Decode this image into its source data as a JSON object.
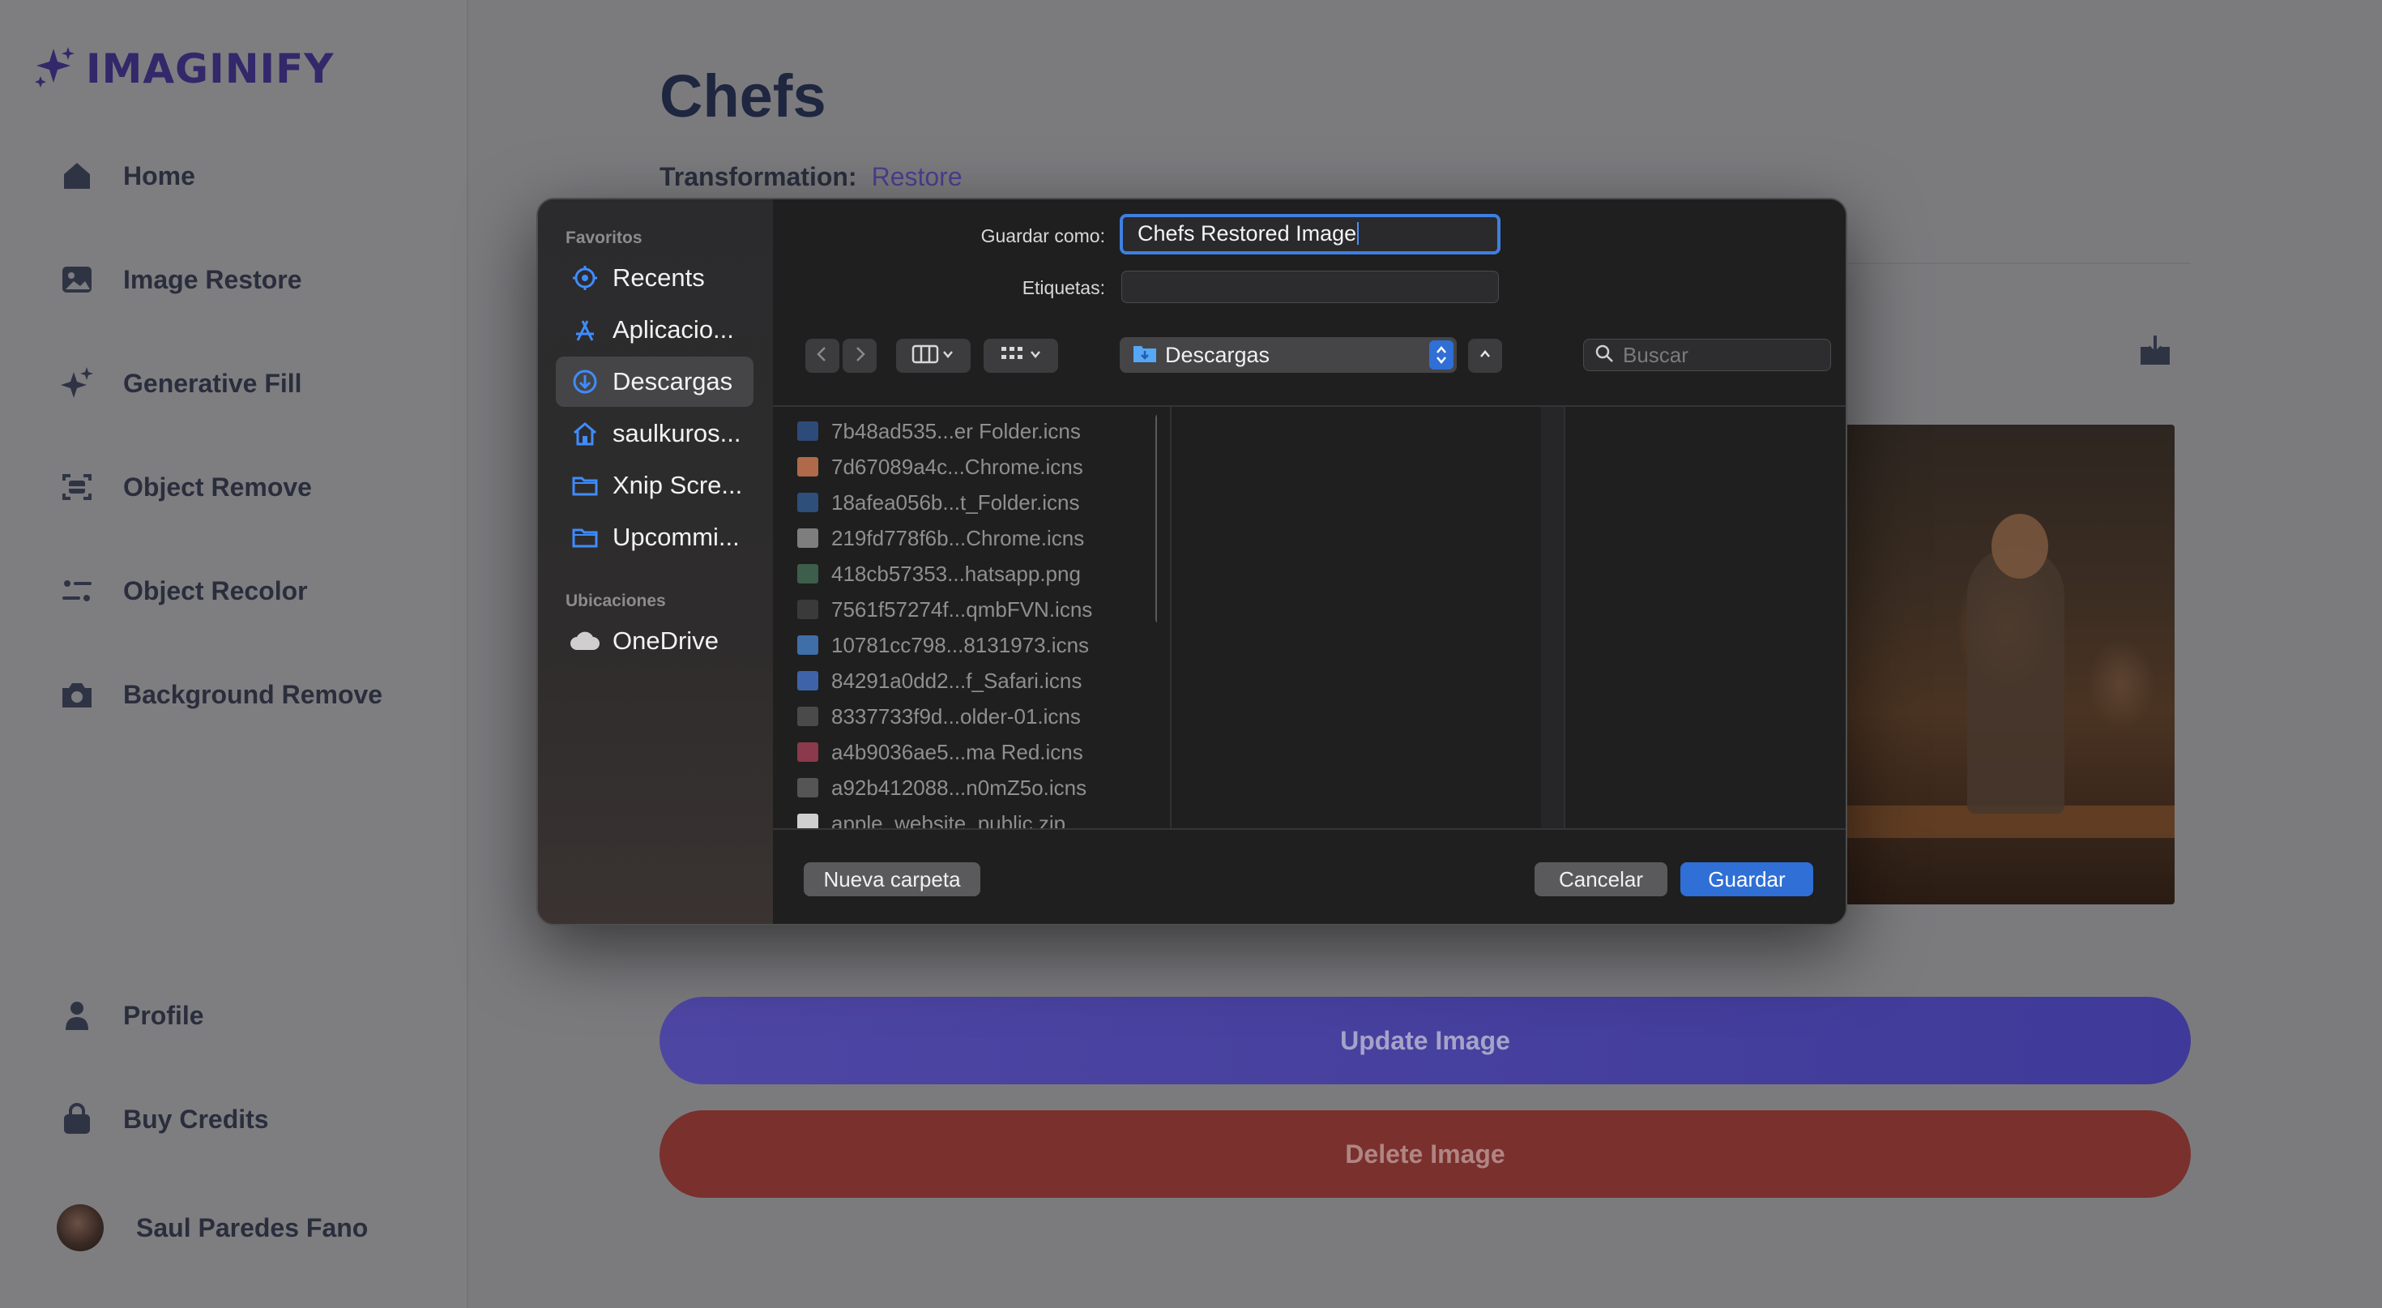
{
  "app": {
    "logo_text": "IMAGINIFY",
    "nav": [
      {
        "label": "Home",
        "icon": "home-icon"
      },
      {
        "label": "Image Restore",
        "icon": "image-icon"
      },
      {
        "label": "Generative Fill",
        "icon": "sparkles-icon"
      },
      {
        "label": "Object Remove",
        "icon": "scan-icon"
      },
      {
        "label": "Object Recolor",
        "icon": "filter-icon"
      },
      {
        "label": "Background Remove",
        "icon": "camera-icon"
      }
    ],
    "bottom_nav": [
      {
        "label": "Profile",
        "icon": "profile-icon"
      },
      {
        "label": "Buy Credits",
        "icon": "bag-icon"
      }
    ],
    "user_name": "Saul Paredes Fano",
    "page_title": "Chefs",
    "transformation_label": "Transformation:",
    "transformation_value": "Restore",
    "update_button": "Update Image",
    "delete_button": "Delete Image",
    "colors": {
      "brand": "#33286a",
      "update": "#4e46a3",
      "delete": "#7a302d"
    }
  },
  "dialog": {
    "save_as_label": "Guardar como:",
    "save_as_value": "Chefs Restored Image",
    "tags_label": "Etiquetas:",
    "favorites_header": "Favoritos",
    "favorites": [
      {
        "label": "Recents",
        "icon": "gear-icon"
      },
      {
        "label": "Aplicacio...",
        "icon": "apps-icon"
      },
      {
        "label": "Descargas",
        "icon": "download-circle-icon",
        "active": true
      },
      {
        "label": "saulkuros...",
        "icon": "house-icon"
      },
      {
        "label": "Xnip Scre...",
        "icon": "folder-icon"
      },
      {
        "label": "Upcommi...",
        "icon": "folder-icon"
      }
    ],
    "locations_header": "Ubicaciones",
    "locations": [
      {
        "label": "OneDrive",
        "icon": "cloud-icon"
      }
    ],
    "location_popup": "Descargas",
    "search_placeholder": "Buscar",
    "files": [
      {
        "name": "7b48ad535...er Folder.icns",
        "icon_color": "#2e4a78"
      },
      {
        "name": "7d67089a4c...Chrome.icns",
        "icon_color": "#b06a4a"
      },
      {
        "name": "18afea056b...t_Folder.icns",
        "icon_color": "#2d4f7a"
      },
      {
        "name": "219fd778f6b...Chrome.icns",
        "icon_color": "#7e7e7e"
      },
      {
        "name": "418cb57353...hatsapp.png",
        "icon_color": "#3d5e4a"
      },
      {
        "name": "7561f57274f...qmbFVN.icns",
        "icon_color": "#3a3a3a"
      },
      {
        "name": "10781cc798...8131973.icns",
        "icon_color": "#3f6ea8"
      },
      {
        "name": "84291a0dd2...f_Safari.icns",
        "icon_color": "#3f63a8"
      },
      {
        "name": "8337733f9d...older-01.icns",
        "icon_color": "#4a4a4a"
      },
      {
        "name": "a4b9036ae5...ma Red.icns",
        "icon_color": "#8a3a4a"
      },
      {
        "name": "a92b412088...n0mZ5o.icns",
        "icon_color": "#555555"
      },
      {
        "name": "apple_website_public.zip",
        "icon_color": "#cfcfcf"
      }
    ],
    "new_folder_button": "Nueva carpeta",
    "cancel_button": "Cancelar",
    "save_button": "Guardar",
    "colors": {
      "accent": "#2f6fd6",
      "focus": "#3f7fe0"
    }
  }
}
